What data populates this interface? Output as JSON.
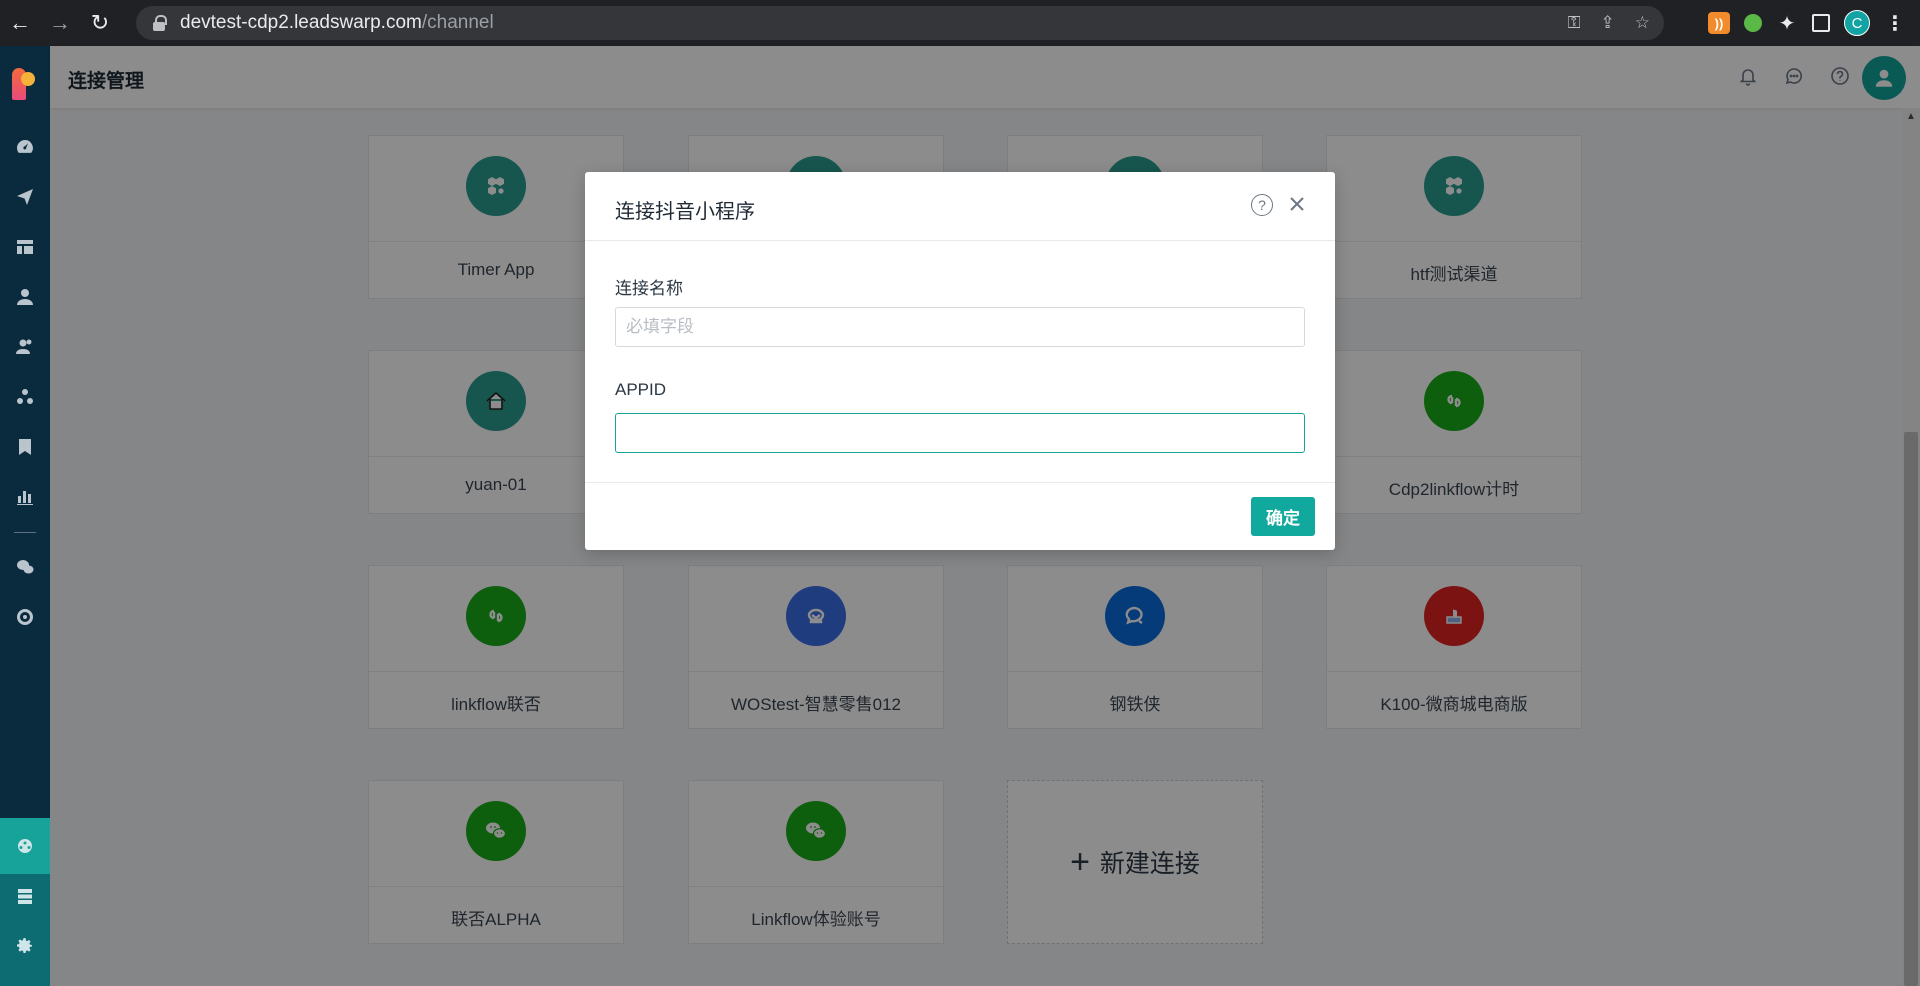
{
  "browser": {
    "url_host": "devtest-cdp2.leadswarp.com",
    "url_path": "/channel",
    "profile_initial": "C"
  },
  "header": {
    "title": "连接管理"
  },
  "channels": [
    {
      "name": "Timer App",
      "icon": "hexagon-gear-icon",
      "color": "#2a9d8f"
    },
    {
      "name": "",
      "icon": "hexagon-gear-icon",
      "color": "#2a9d8f"
    },
    {
      "name": "",
      "icon": "hexagon-gear-icon",
      "color": "#2a9d8f"
    },
    {
      "name": "htf测试渠道",
      "icon": "hexagon-gear-icon",
      "color": "#2a9d8f"
    },
    {
      "name": "yuan-01",
      "icon": "house-icon",
      "color": "#2a9d8f"
    },
    {
      "name": "",
      "icon": "mini-program-icon",
      "color": "#1aad19"
    },
    {
      "name": "",
      "icon": "mini-program-icon",
      "color": "#1aad19"
    },
    {
      "name": "Cdp2linkflow计时",
      "icon": "mini-program-icon",
      "color": "#1aad19"
    },
    {
      "name": "linkflow联否",
      "icon": "mini-program-icon",
      "color": "#1aad19"
    },
    {
      "name": "WOStest-智慧零售012",
      "icon": "smart-retail-icon",
      "color": "#3a6ee8"
    },
    {
      "name": "钢铁侠",
      "icon": "chat-bubble-icon",
      "color": "#0a6cdb"
    },
    {
      "name": "K100-微商城电商版",
      "icon": "shop-thumb-icon",
      "color": "#e22424"
    },
    {
      "name": "联否ALPHA",
      "icon": "wechat-icon",
      "color": "#1aad19"
    },
    {
      "name": "Linkflow体验账号",
      "icon": "wechat-icon",
      "color": "#1aad19"
    }
  ],
  "new_connection": {
    "label": "新建连接"
  },
  "modal": {
    "title": "连接抖音小程序",
    "help_symbol": "?",
    "name_label": "连接名称",
    "name_placeholder": "必填字段",
    "name_value": "",
    "appid_label": "APPID",
    "appid_value": "",
    "confirm_label": "确定"
  }
}
